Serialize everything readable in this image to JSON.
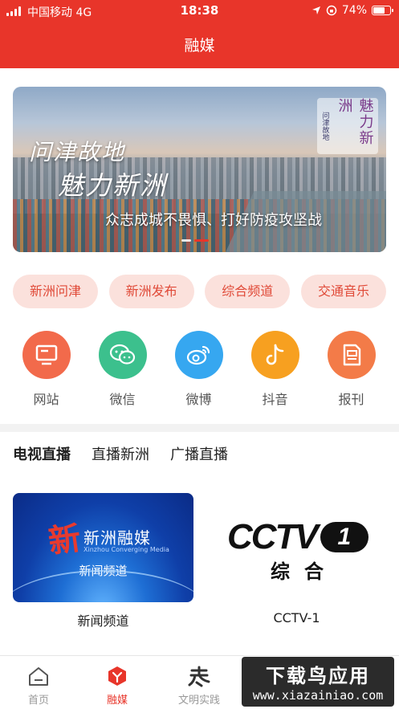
{
  "status_bar": {
    "carrier": "中国移动",
    "network": "4G",
    "time": "18:38",
    "battery": "74%",
    "battery_level": 0.74
  },
  "header": {
    "title": "融媒"
  },
  "banner": {
    "slogan_line1": "问津故地",
    "slogan_line2": "魅力新洲",
    "seal_main": "魅力新洲",
    "seal_side": "问津故地",
    "caption": "众志成城不畏惧、打好防疫攻坚战",
    "dots": 2,
    "active_dot": 1
  },
  "quick_tags": [
    "新洲问津",
    "新洲发布",
    "综合频道",
    "交通音乐"
  ],
  "social": [
    {
      "label": "网站",
      "icon": "website-icon",
      "color": "#f26a4b"
    },
    {
      "label": "微信",
      "icon": "wechat-icon",
      "color": "#3cc08d"
    },
    {
      "label": "微博",
      "icon": "weibo-icon",
      "color": "#36a7f0"
    },
    {
      "label": "抖音",
      "icon": "douyin-icon",
      "color": "#f7a020"
    },
    {
      "label": "报刊",
      "icon": "newspaper-icon",
      "color": "#f37b48"
    }
  ],
  "live_tabs": [
    "电视直播",
    "直播新洲",
    "广播直播"
  ],
  "channels": [
    {
      "name": "新闻频道",
      "thumb_logo": "新",
      "thumb_brand": "新洲融媒",
      "thumb_sub": "Xinzhou Converging Media",
      "thumb_channel": "新闻频道"
    },
    {
      "name": "CCTV-1",
      "thumb_text": "CCTV",
      "thumb_num": "1",
      "thumb_sub": "综合"
    }
  ],
  "tabbar": [
    {
      "label": "首页",
      "icon": "home-icon"
    },
    {
      "label": "融媒",
      "icon": "media-icon",
      "active": true
    },
    {
      "label": "文明实践",
      "icon": "civilization-icon"
    }
  ],
  "watermark": {
    "line1": "下载鸟应用",
    "line2": "www.xiazainiao.com"
  },
  "colors": {
    "brand_red": "#e8352a",
    "tag_bg": "#fbe1dc",
    "tag_text": "#e04a38"
  }
}
